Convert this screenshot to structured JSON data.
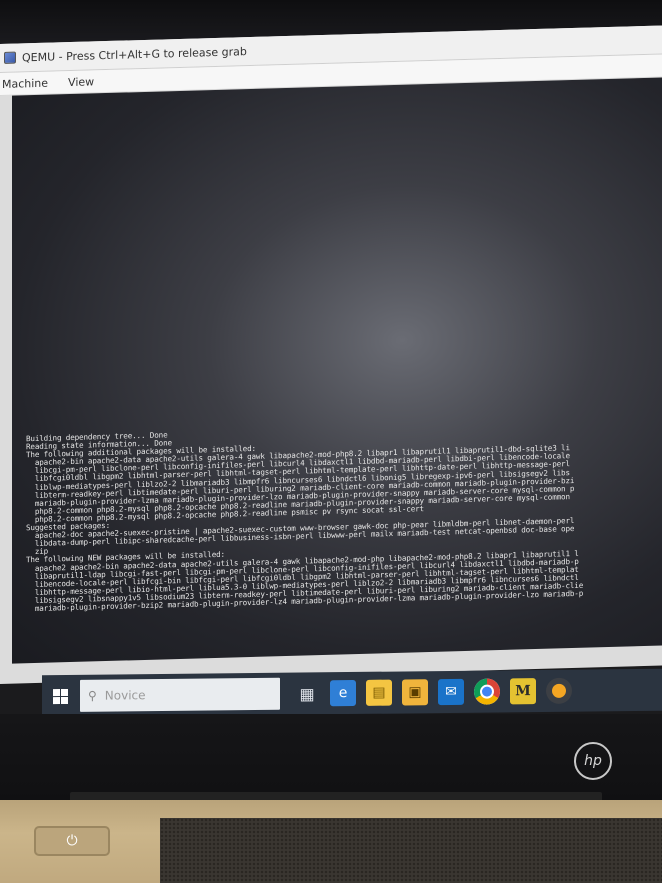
{
  "window": {
    "title": "QEMU - Press Ctrl+Alt+G to release grab",
    "menu": [
      "Machine",
      "View"
    ]
  },
  "console": {
    "lines": [
      "Building dependency tree... Done",
      "Reading state information... Done",
      "The following additional packages will be installed:",
      "  apache2-bin apache2-data apache2-utils galera-4 gawk libapache2-mod-php8.2 libapr1 libaprutil1 libaprutil1-dbd-sqlite3 li",
      "  libcgi-pm-perl libclone-perl libconfig-inifiles-perl libcurl4 libdaxctl1 libdbd-mariadb-perl libdbi-perl libencode-locale",
      "  libfcgi0ldbl libgpm2 libhtml-parser-perl libhtml-tagset-perl libhtml-template-perl libhttp-date-perl libhttp-message-perl",
      "  liblwp-mediatypes-perl liblzo2-2 libmariadb3 libmpfr6 libncurses6 libndctl6 libonig5 libregexp-ipv6-perl libsigsegv2 libs",
      "  libterm-readkey-perl libtimedate-perl liburi-perl liburing2 mariadb-client-core mariadb-common mariadb-plugin-provider-bzi",
      "  mariadb-plugin-provider-lzma mariadb-plugin-provider-lzo mariadb-plugin-provider-snappy mariadb-server-core mysql-common p",
      "  php8.2-common php8.2-mysql php8.2-opcache php8.2-readline mariadb-plugin-provider-snappy mariadb-server-core mysql-common",
      "  php8.2-common php8.2-mysql php8.2-opcache php8.2-readline psmisc pv rsync socat ssl-cert",
      "Suggested packages:",
      "  apache2-doc apache2-suexec-pristine | apache2-suexec-custom www-browser gawk-doc php-pear libmldbm-perl libnet-daemon-perl",
      "  libdata-dump-perl libipc-sharedcache-perl libbusiness-isbn-perl libwww-perl mailx mariadb-test netcat-openbsd doc-base ope",
      "  zip",
      "The following NEW packages will be installed:",
      "  apache2 apache2-bin apache2-data apache2-utils galera-4 gawk libapache2-mod-php libapache2-mod-php8.2 libapr1 libaprutil1 l",
      "  libaprutil1-ldap libcgi-fast-perl libcgi-pm-perl libclone-perl libconfig-inifiles-perl libcurl4 libdaxctl1 libdbd-mariadb-p",
      "  libencode-locale-perl libfcgi-bin libfcgi-perl libfcgi0ldbl libgpm2 libhtml-parser-perl libhtml-tagset-perl libhtml-templat",
      "  libhttp-message-perl libio-html-perl liblua5.3-0 liblwp-mediatypes-perl liblzo2-2 libmariadb3 libmpfr6 libncurses6 libndctl",
      "  libsigsegv2 libsnappy1v5 libsodium23 libterm-readkey-perl libtimedate-perl liburi-perl liburing2 mariadb-client mariadb-clie",
      "  mariadb-plugin-provider-bzip2 mariadb-plugin-provider-lz4 mariadb-plugin-provider-lzma mariadb-plugin-provider-lzo mariadb-p"
    ]
  },
  "taskbar": {
    "search_placeholder": "Novice",
    "icons": [
      "windows-icon",
      "search-icon",
      "task-view-icon",
      "edge-icon",
      "file-explorer-icon",
      "store-icon",
      "outlook-icon",
      "chrome-icon",
      "m-app-icon",
      "app-icon"
    ],
    "letters": {
      "m_app": "M"
    }
  },
  "laptop": {
    "brand": "hp"
  },
  "colors": {
    "console_text": "#e6e6e6",
    "taskbar_bg": "#2b3440",
    "deck_gold": "#c2ab80"
  }
}
